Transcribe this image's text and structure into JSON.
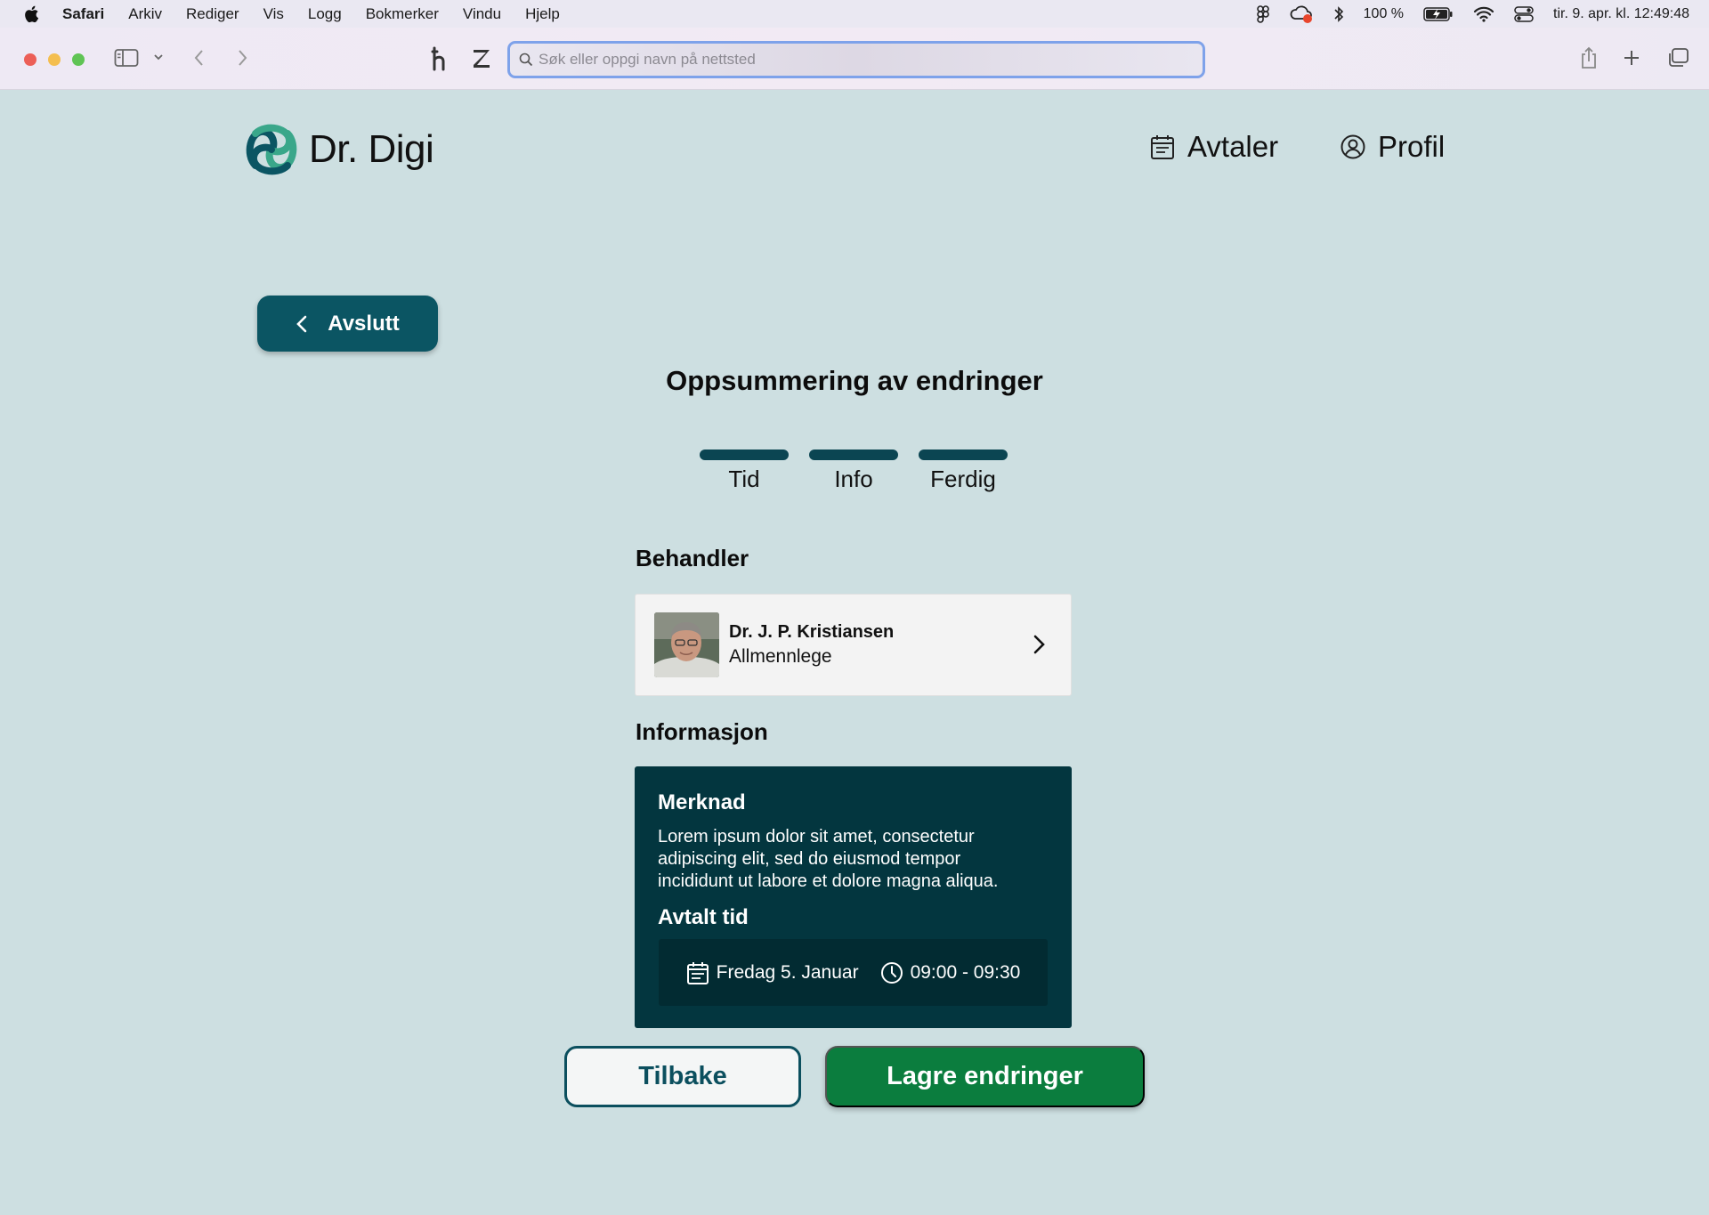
{
  "menubar": {
    "items": [
      "Safari",
      "Arkiv",
      "Rediger",
      "Vis",
      "Logg",
      "Bokmerker",
      "Vindu",
      "Hjelp"
    ],
    "battery": "100 %",
    "datetime": "tir. 9. apr. kl. 12:49:48"
  },
  "browser": {
    "address_placeholder": "Søk eller oppgi navn på nettsted",
    "address_value": ""
  },
  "app": {
    "logo_text": "Dr. Digi",
    "nav": {
      "appointments": "Avtaler",
      "profile": "Profil"
    }
  },
  "page": {
    "exit_label": "Avslutt",
    "title": "Oppsummering av endringer",
    "steps": [
      "Tid",
      "Info",
      "Ferdig"
    ]
  },
  "practitioner": {
    "section_title": "Behandler",
    "name": "Dr. J. P. Kristiansen",
    "role": "Allmennlege"
  },
  "information": {
    "section_title": "Informasjon",
    "note_title": "Merknad",
    "note_text": "Lorem ipsum dolor sit amet, consectetur adipiscing elit, sed do eiusmod tempor incididunt ut labore et dolore magna aliqua.",
    "appointment_title": "Avtalt tid",
    "date": "Fredag 5. Januar",
    "time": "09:00 - 09:30"
  },
  "actions": {
    "back": "Tilbake",
    "save": "Lagre endringer"
  },
  "colors": {
    "background": "#cddfe1",
    "primary": "#0b5563",
    "dark_card": "#03363f",
    "save_green": "#0b7d3e",
    "logo_green": "#3aa78a",
    "logo_teal": "#0b5563"
  }
}
